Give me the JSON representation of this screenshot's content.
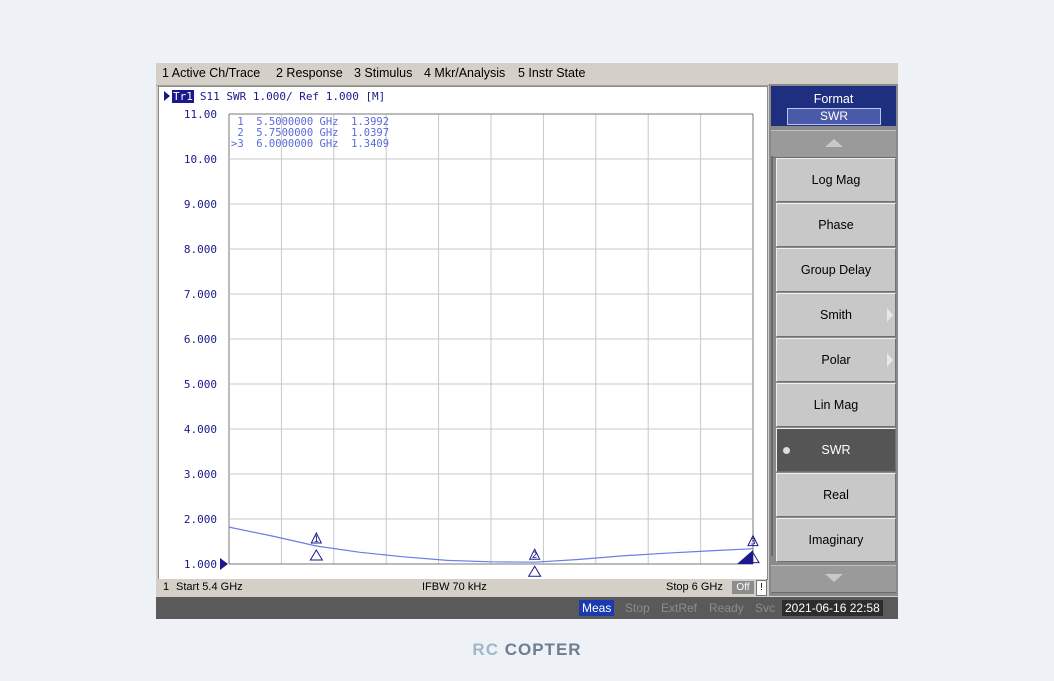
{
  "menu": [
    "1 Active Ch/Trace",
    "2 Response",
    "3 Stimulus",
    "4 Mkr/Analysis",
    "5 Instr State"
  ],
  "trace": {
    "tag": "Tr1",
    "header": "S11  SWR 1.000/ Ref 1.000 [M]"
  },
  "y_axis_labels": [
    "11.00",
    "10.00",
    "9.000",
    "8.000",
    "7.000",
    "6.000",
    "5.000",
    "4.000",
    "3.000",
    "2.000",
    "1.000"
  ],
  "markers": [
    {
      "id": "1",
      "prefix": " ",
      "freq": "5.5000000 GHz",
      "value": "1.3992"
    },
    {
      "id": "2",
      "prefix": " ",
      "freq": "5.7500000 GHz",
      "value": "1.0397"
    },
    {
      "id": "3",
      "prefix": ">",
      "freq": "6.0000000 GHz",
      "value": "1.3409"
    }
  ],
  "chart_data": {
    "type": "line",
    "x_range_ghz": [
      5.4,
      6.0
    ],
    "ylim": [
      1.0,
      11.0
    ],
    "y_divisions": 10,
    "x_divisions": 10,
    "grid": true,
    "series": [
      {
        "x": [
          5.4,
          5.45,
          5.5,
          5.55,
          5.6,
          5.65,
          5.7,
          5.75,
          5.8,
          5.85,
          5.9,
          5.95,
          6.0
        ],
        "values": [
          1.82,
          1.62,
          1.4,
          1.26,
          1.16,
          1.08,
          1.05,
          1.04,
          1.1,
          1.18,
          1.24,
          1.29,
          1.34
        ]
      }
    ],
    "marker_points": [
      {
        "label": "1",
        "x": 5.5,
        "y": 1.3992
      },
      {
        "label": "2",
        "x": 5.75,
        "y": 1.0397
      },
      {
        "label": "3",
        "x": 6.0,
        "y": 1.3409
      }
    ],
    "line_color": "#6b7de6"
  },
  "status_bar": {
    "channel": "1",
    "start": "Start 5.4 GHz",
    "ifbw": "IFBW 70 kHz",
    "stop": "Stop 6 GHz",
    "off": "Off",
    "bang": "!"
  },
  "bottom_status": {
    "meas": "Meas",
    "stop": "Stop",
    "extref": "ExtRef",
    "ready": "Ready",
    "svc": "Svc",
    "datetime": "2021-06-16 22:58"
  },
  "softkeys": {
    "title": "Format",
    "value": "SWR",
    "items": [
      {
        "label": "Log Mag",
        "selected": false,
        "submenu": false
      },
      {
        "label": "Phase",
        "selected": false,
        "submenu": false
      },
      {
        "label": "Group Delay",
        "selected": false,
        "submenu": false
      },
      {
        "label": "Smith",
        "selected": false,
        "submenu": true
      },
      {
        "label": "Polar",
        "selected": false,
        "submenu": true
      },
      {
        "label": "Lin Mag",
        "selected": false,
        "submenu": false
      },
      {
        "label": "SWR",
        "selected": true,
        "submenu": false
      },
      {
        "label": "Real",
        "selected": false,
        "submenu": false
      },
      {
        "label": "Imaginary",
        "selected": false,
        "submenu": false
      }
    ]
  },
  "watermark": {
    "part1": "RC",
    "part2": "COPTER"
  }
}
